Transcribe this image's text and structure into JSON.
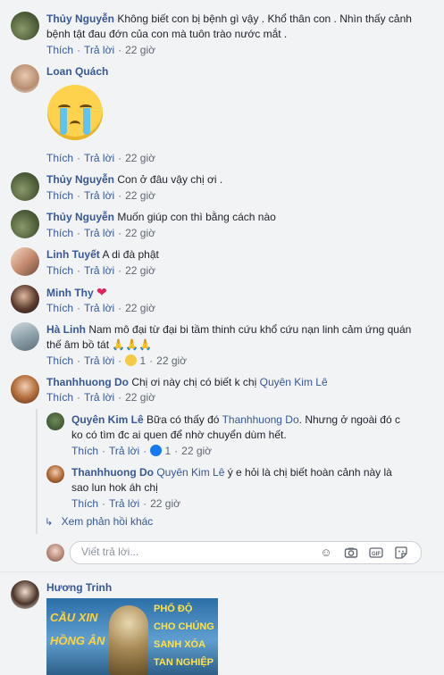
{
  "comments": [
    {
      "name": "Thủy Nguyễn",
      "text1": "Không biết con bị bệnh gì vậy . Khổ thân con . Nhìn thấy cảnh",
      "text2": "bệnh tật đau đớn của con mà tuôn trào nước mắt .",
      "like": "Thích",
      "reply": "Trả lời",
      "time": "22 giờ"
    },
    {
      "name": "Loan Quách",
      "sticker": "crying-face",
      "like": "Thích",
      "reply": "Trả lời",
      "time": "22 giờ"
    },
    {
      "name": "Thủy Nguyễn",
      "text1": "Con ở đâu vậy chị ơi .",
      "like": "Thích",
      "reply": "Trả lời",
      "time": "22 giờ"
    },
    {
      "name": "Thủy Nguyễn",
      "text1": "Muốn giúp con thì bằng cách nào",
      "like": "Thích",
      "reply": "Trả lời",
      "time": "22 giờ"
    },
    {
      "name": "Linh Tuyết",
      "text1": "A di đà phật",
      "like": "Thích",
      "reply": "Trả lời",
      "time": "22 giờ"
    },
    {
      "name": "Minh Thy",
      "text1": "❤",
      "like": "Thích",
      "reply": "Trả lời",
      "time": "22 giờ"
    },
    {
      "name": "Hà Linh",
      "text1": "Nam mô đại từ đại bi tầm thinh cứu khổ cứu nạn linh cảm ứng quán",
      "text2": "thế âm bồ tát 🙏🙏🙏",
      "like": "Thích",
      "reply": "Trả lời",
      "reactions": "1",
      "time": "22 giờ"
    },
    {
      "name": "Thanhhuong Do",
      "text1": "Chị ơi này chị có biết k chị",
      "mention": "Quyên Kim Lê",
      "like": "Thích",
      "reply": "Trả lời",
      "time": "22 giờ"
    }
  ],
  "replies": [
    {
      "name": "Quyên Kim Lê",
      "text1a": "Bữa có thấy đó",
      "mention": "Thanhhuong Do",
      "text1b": ". Nhưng ở ngoài đó c",
      "text2": "ko có tìm đc ai quen để nhờ chuyển dùm hết.",
      "like": "Thích",
      "reply": "Trả lời",
      "reactions": "1",
      "time": "22 giờ"
    },
    {
      "name": "Thanhhuong Do",
      "mention": "Quyên Kim Lê",
      "text1": "ý e hỏi là chị biết hoàn cảnh này là",
      "text2": "sao lun hok áh chị",
      "like": "Thích",
      "reply": "Trả lời",
      "time": "22 giờ"
    }
  ],
  "more_replies": "Xem phản hồi khác",
  "reply_box": {
    "placeholder": "Viết trả lời..."
  },
  "last": {
    "name": "Hương Trinh",
    "banner_left1": "CẦU XIN",
    "banner_left2": "HỒNG ÂN",
    "banner_right1": "PHỔ ĐỘ",
    "banner_right2": "CHO CHÚNG",
    "banner_right3": "SANH XÓA",
    "banner_right4": "TAN NGHIỆP"
  }
}
